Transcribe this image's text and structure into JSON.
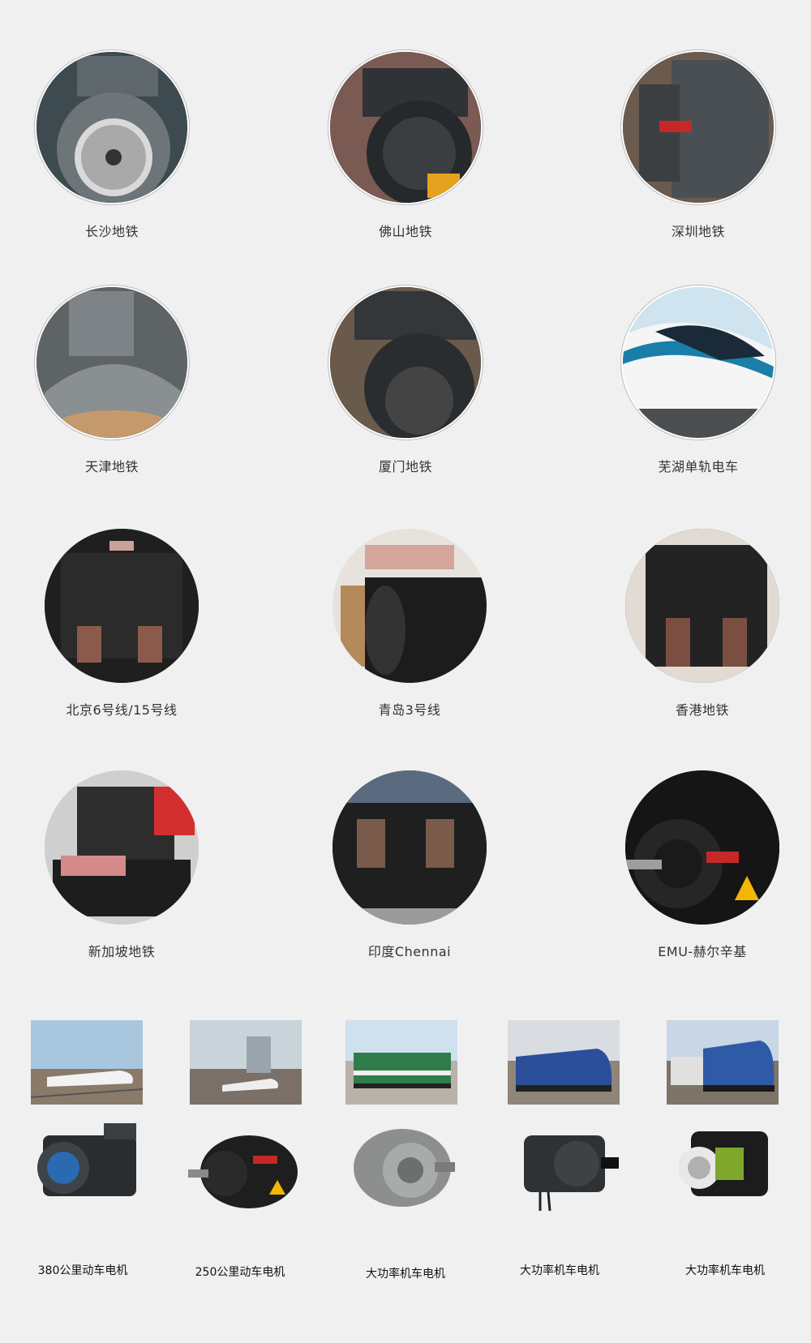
{
  "projects": [
    {
      "label": "长沙地铁",
      "icon": "traction-motor-icon"
    },
    {
      "label": "佛山地铁",
      "icon": "traction-motor-icon"
    },
    {
      "label": "深圳地铁",
      "icon": "traction-motor-icon"
    },
    {
      "label": "天津地铁",
      "icon": "traction-motor-icon"
    },
    {
      "label": "厦门地铁",
      "icon": "traction-motor-icon"
    },
    {
      "label": "芜湖单轨电车",
      "icon": "monorail-train-icon"
    },
    {
      "label": "北京6号线/15号线",
      "icon": "traction-motor-icon"
    },
    {
      "label": "青岛3号线",
      "icon": "traction-motor-icon"
    },
    {
      "label": "香港地铁",
      "icon": "traction-motor-icon"
    },
    {
      "label": "新加坡地铁",
      "icon": "traction-motor-icon"
    },
    {
      "label": "印度Chennai",
      "icon": "traction-motor-icon"
    },
    {
      "label": "EMU-赫尔辛基",
      "icon": "traction-motor-icon"
    }
  ],
  "locomotive_products": [
    {
      "label": "380公里动车电机",
      "train_icon": "high-speed-train-icon",
      "motor_icon": "motor-icon"
    },
    {
      "label": "250公里动车电机",
      "train_icon": "high-speed-train-icon",
      "motor_icon": "motor-icon"
    },
    {
      "label": "大功率机车电机",
      "train_icon": "diesel-locomotive-icon",
      "motor_icon": "motor-icon"
    },
    {
      "label": "大功率机车电机",
      "train_icon": "electric-locomotive-icon",
      "motor_icon": "motor-icon"
    },
    {
      "label": "大功率机车电机",
      "train_icon": "electric-locomotive-icon",
      "motor_icon": "motor-icon"
    }
  ],
  "colors": {
    "background": "#f0f0f0",
    "motor_grey": "#5d6468",
    "motor_black": "#1e1e1e",
    "monorail_blue": "#1a7fa8",
    "locomotive_green": "#2f7d4a",
    "locomotive_blue": "#2b4f9a"
  }
}
